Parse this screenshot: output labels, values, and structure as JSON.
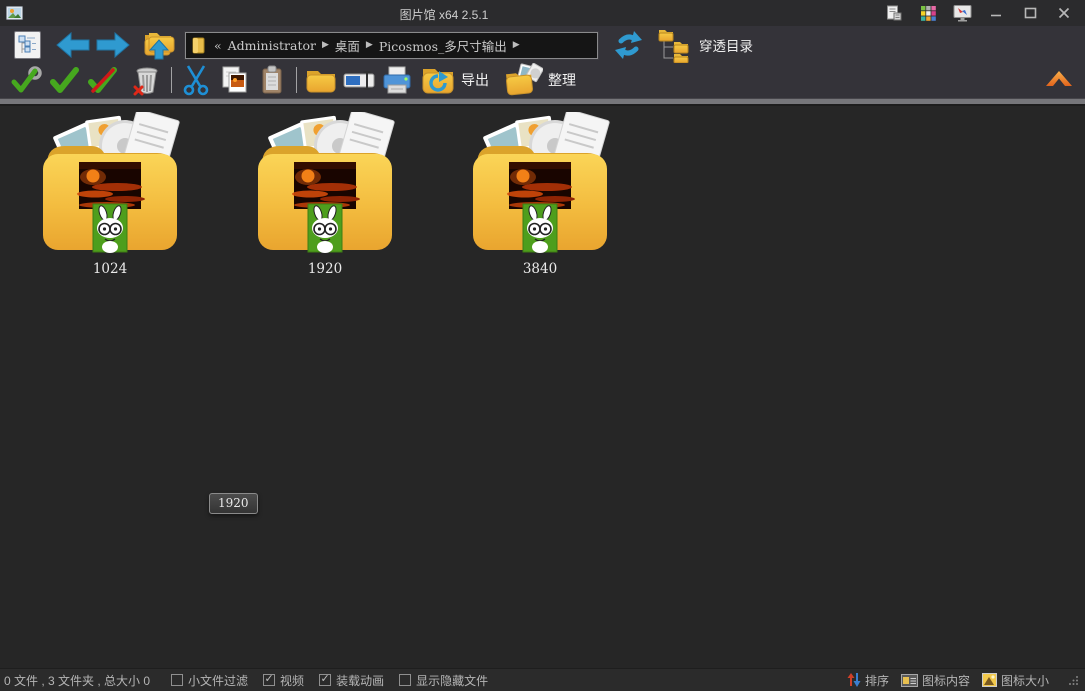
{
  "window": {
    "title": "图片馆 x64 2.5.1"
  },
  "breadcrumb": {
    "collapse": "«",
    "separator": "▶",
    "segments": [
      "Administrator",
      "桌面",
      "Picosmos_多尺寸输出"
    ]
  },
  "toolbar": {
    "passthrough_label": "穿透目录",
    "export_label": "导出",
    "organize_label": "整理"
  },
  "folders": [
    {
      "label": "1024"
    },
    {
      "label": "1920"
    },
    {
      "label": "3840"
    }
  ],
  "tooltip": {
    "text": "1920"
  },
  "statusbar": {
    "summary": "0 文件 , 3 文件夹 , 总大小 0",
    "filters": [
      {
        "label": "小文件过滤",
        "checked": false
      },
      {
        "label": "视频",
        "checked": true
      },
      {
        "label": "装载动画",
        "checked": true
      },
      {
        "label": "显示隐藏文件",
        "checked": false
      }
    ],
    "tools": [
      {
        "label": "排序"
      },
      {
        "label": "图标内容"
      },
      {
        "label": "图标大小"
      }
    ]
  },
  "icons": {
    "app-icon": "small-picture",
    "list-settings-icon": "document-list",
    "color-grid-icon": "3x3-color-squares",
    "display-icon": "monitor-arrows",
    "minimize-icon": "—",
    "maximize-icon": "□",
    "close-icon": "✕",
    "tree-view-icon": "tree-list",
    "back-icon": "◀ blue arrow",
    "forward-icon": "▶ blue arrow",
    "folder-up-icon": "folder with up arrow",
    "breadcrumb-folder-icon": "folder",
    "refresh-icon": "circular blue arrows",
    "passthrough-icon": "folder tree",
    "tools-check-icon": "wrench + green check",
    "select-all-icon": "green check",
    "deselect-icon": "green check with red slash",
    "delete-icon": "trash can with red x",
    "cut-icon": "blue scissors",
    "copy-icon": "photo copy",
    "paste-icon": "clipboard",
    "new-folder-icon": "folder",
    "rename-icon": "text field with cursor",
    "print-icon": "printer",
    "export-icon": "folder with circular arrow",
    "organize-icon": "folder with photos",
    "collapse-toolbar-icon": "orange chevron up",
    "folder-art-icon": "yellow folder with photos, sunset thumbnail, green rabbit tag",
    "sort-icon": "red/blue sort arrows",
    "icon-content-icon": "small window",
    "icon-size-icon": "small picture",
    "resize-grip": "dot triangle"
  },
  "colors": {
    "titlebar_bg": "#2b2b2d",
    "toolbar_bg": "#343339",
    "content_bg": "#262626",
    "statusbar_bg": "#2b2b2b",
    "separator_gray": "#76767a",
    "accent_blue": "#2f9ad0",
    "folder_yellow": "#f3bc3f",
    "check_green": "#46a81e",
    "chevron_orange": "#f08a1d",
    "tag_green": "#4e9e1d"
  }
}
